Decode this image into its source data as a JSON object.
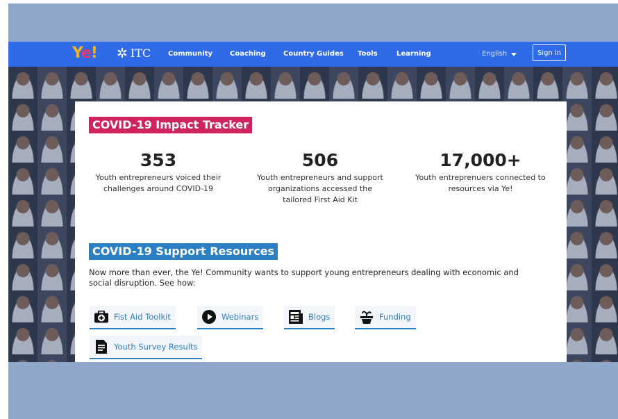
{
  "nav": {
    "logo_ye_y": "Y",
    "logo_ye_e": "e",
    "logo_ye_bang": "!",
    "logo_itc_mark": "✲",
    "logo_itc_text": "ITC",
    "links": [
      "Community",
      "Coaching",
      "Country Guides",
      "Tools",
      "Learning"
    ],
    "language": "English",
    "signin_label": "Sign in"
  },
  "tracker": {
    "title": "COVID-19 Impact Tracker",
    "stats": [
      {
        "value": "353",
        "lines": [
          "Youth entrepreneurs voiced their",
          "challenges around COVID-19"
        ]
      },
      {
        "value": "506",
        "lines": [
          "Youth entrepreneurs and support",
          "organizations accessed the",
          "tailored First Aid Kit"
        ]
      },
      {
        "value": "17,000+",
        "lines": [
          "Youth entreprenuers connected to",
          "resources via Ye!"
        ]
      }
    ]
  },
  "support": {
    "title": "COVID-19 Support Resources",
    "intro_lines": [
      "Now more than ever, the Ye! Community wants to support young entrepreneurs dealing with economic and",
      "social disruption. See how:"
    ],
    "buttons": [
      {
        "label": "Fist Aid Toolkit",
        "icon": "first-aid-kit-icon"
      },
      {
        "label": "Webinars",
        "icon": "play-circle-icon"
      },
      {
        "label": "Blogs",
        "icon": "newspaper-icon"
      },
      {
        "label": "Funding",
        "icon": "plant-pot-icon"
      },
      {
        "label": "Youth Survey Results",
        "icon": "document-icon"
      }
    ]
  },
  "colors": {
    "nav_bg": "#2f6be9",
    "tracker_accent": "#d0245c",
    "support_accent": "#2c7fc2",
    "frame_bg": "#8fa8c9"
  }
}
